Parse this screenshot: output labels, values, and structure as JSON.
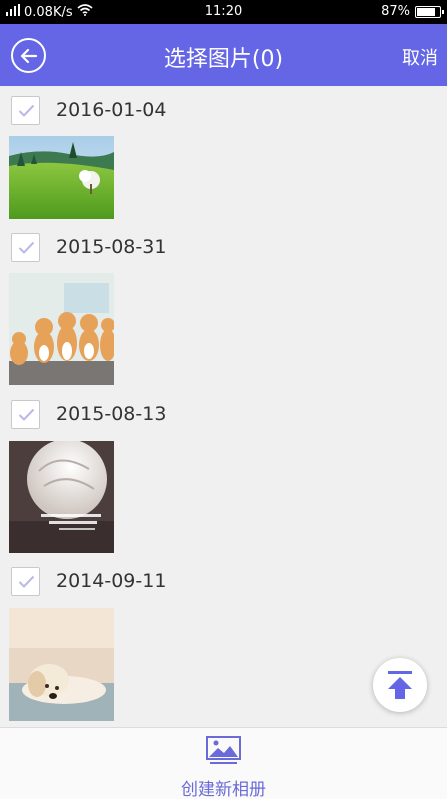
{
  "status_bar": {
    "network": "0.08K/s",
    "time": "11:20",
    "battery": "87%",
    "battery_level": 0.87
  },
  "header": {
    "title": "选择图片(0)",
    "cancel_label": "取消"
  },
  "groups": [
    {
      "date": "2016-01-04",
      "photo": "green-hill-landscape"
    },
    {
      "date": "2015-08-31",
      "photo": "kittens-row"
    },
    {
      "date": "2015-08-13",
      "photo": "white-rose"
    },
    {
      "date": "2014-09-11",
      "photo": "puppy-on-bed"
    }
  ],
  "bottom": {
    "create_album_label": "创建新相册"
  },
  "colors": {
    "accent": "#6466e6",
    "background": "#f0f0f0"
  }
}
